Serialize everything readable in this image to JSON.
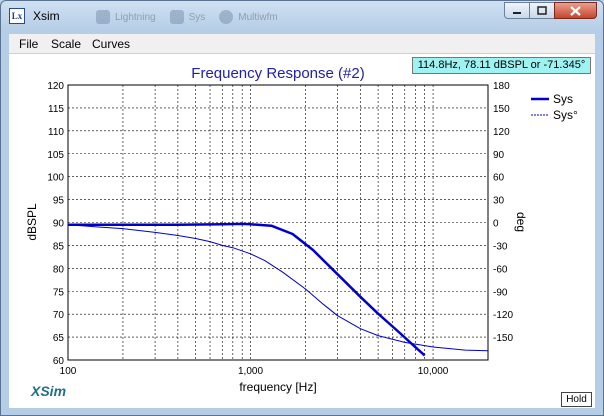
{
  "window": {
    "title": "Xsim",
    "app_icon": "xsim-app-icon",
    "taskbar_ghost": [
      "Lightning",
      "Sys",
      "Multiwfm"
    ],
    "controls": [
      "minimize-icon",
      "maximize-icon",
      "close-icon"
    ]
  },
  "menu": {
    "items": [
      "File",
      "Scale",
      "Curves"
    ]
  },
  "plot": {
    "readout": "114.8Hz, 78.11 dBSPL or -71.345°",
    "brand_label": "XSim",
    "hold_label": "Hold"
  },
  "chart_data": {
    "type": "line",
    "title": "Frequency Response (#2)",
    "xlabel": "frequency [Hz]",
    "ylabel_left": "dBSPL",
    "ylabel_right": "deg",
    "x_scale": "log",
    "xlim": [
      100,
      20000
    ],
    "ylim_left": [
      60,
      120
    ],
    "ylim_right": [
      -180,
      180
    ],
    "x_tick_labels": [
      {
        "value": 100,
        "label": "100"
      },
      {
        "value": 1000,
        "label": "1,000"
      },
      {
        "value": 10000,
        "label": "10,000"
      }
    ],
    "y_left_ticks": [
      60,
      65,
      70,
      75,
      80,
      85,
      90,
      95,
      100,
      105,
      110,
      115,
      120
    ],
    "y_right_ticks": [
      -150,
      -120,
      -90,
      -60,
      -30,
      0,
      30,
      60,
      90,
      120,
      150,
      180
    ],
    "grid": true,
    "legend_position": "top-right",
    "series": [
      {
        "name": "Sys",
        "axis": "left",
        "color": "#0000cc",
        "style": "solid-thick",
        "x": [
          100,
          200,
          400,
          700,
          900,
          1000,
          1300,
          1700,
          2200,
          3000,
          4000,
          5000,
          6000,
          7000,
          8000,
          9000
        ],
        "y": [
          89.5,
          89.5,
          89.5,
          89.6,
          89.7,
          89.6,
          89.3,
          87.5,
          84,
          78.7,
          73.8,
          70.1,
          67.3,
          64.9,
          62.8,
          61.0
        ]
      },
      {
        "name": "Sys°",
        "axis": "right",
        "color": "#0000cc",
        "style": "thin",
        "x": [
          100,
          150,
          200,
          300,
          400,
          500,
          600,
          700,
          800,
          1000,
          1200,
          1500,
          2000,
          2500,
          3000,
          4000,
          5000,
          7000,
          10000,
          15000,
          20000
        ],
        "y": [
          -3,
          -6,
          -8,
          -13,
          -17,
          -21,
          -25,
          -30,
          -33,
          -41,
          -50,
          -65,
          -87,
          -107,
          -122,
          -139,
          -148,
          -157,
          -163,
          -167,
          -168
        ]
      }
    ]
  }
}
